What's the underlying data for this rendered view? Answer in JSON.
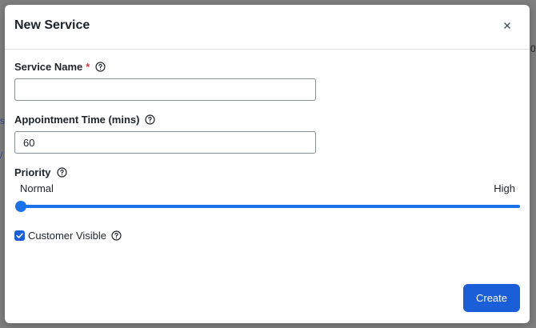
{
  "background": {
    "fragments": [
      "0",
      "s",
      "/"
    ]
  },
  "modal": {
    "title": "New Service",
    "close_icon": "close-icon"
  },
  "form": {
    "service_name": {
      "label": "Service Name",
      "required_mark": "*",
      "value": "",
      "help_icon": "help-circle-icon"
    },
    "appointment_time": {
      "label": "Appointment Time (mins)",
      "value": "60",
      "help_icon": "help-circle-icon"
    },
    "priority": {
      "label": "Priority",
      "min_label": "Normal",
      "max_label": "High",
      "level": 0,
      "help_icon": "help-circle-icon"
    },
    "customer_visible": {
      "label": "Customer Visible",
      "checked": true,
      "help_icon": "help-circle-icon"
    }
  },
  "footer": {
    "create_label": "Create"
  },
  "colors": {
    "accent": "#1a5fd8",
    "slider": "#1a73e8",
    "required": "#dc3545",
    "overlay": "#7f7f7f"
  }
}
